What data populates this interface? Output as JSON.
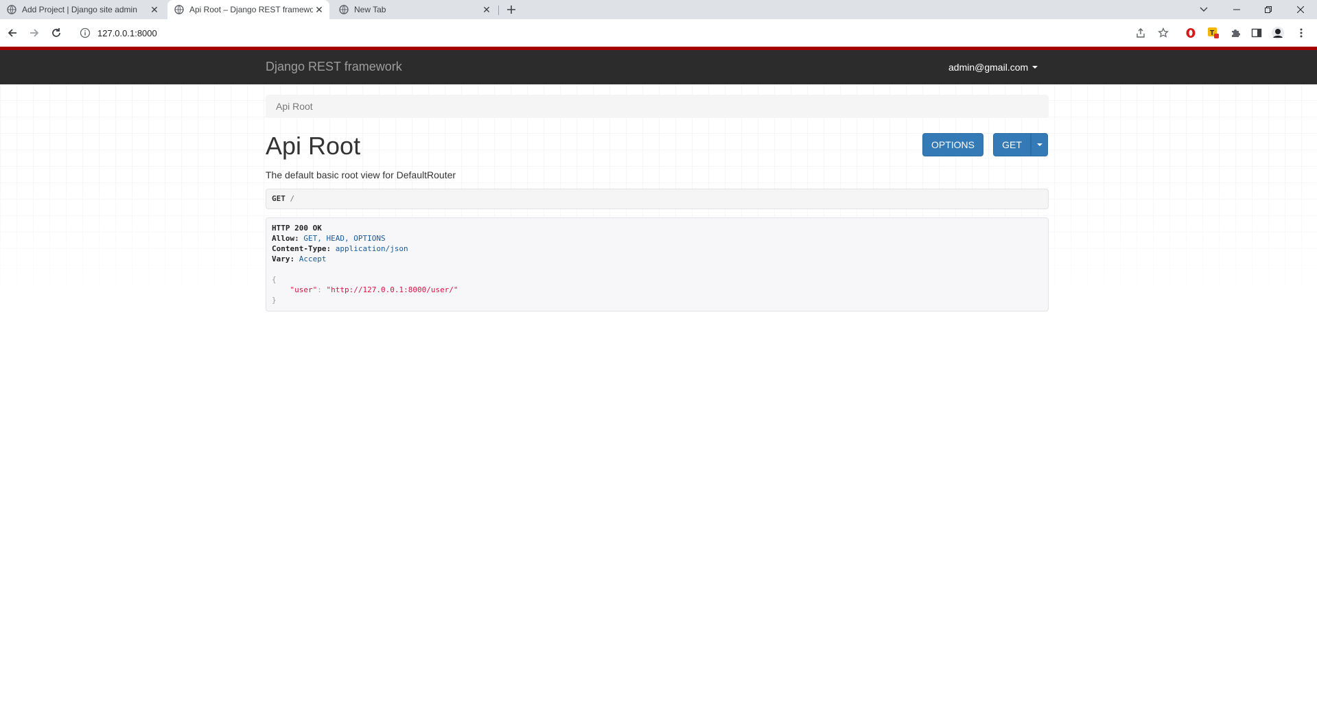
{
  "browser": {
    "tabs": [
      {
        "title": "Add Project | Django site admin",
        "active": false
      },
      {
        "title": "Api Root – Django REST framework",
        "active": true
      },
      {
        "title": "New Tab",
        "active": false
      }
    ],
    "new_tab_icon": "plus-icon",
    "url": "127.0.0.1:8000"
  },
  "navbar": {
    "brand": "Django REST framework",
    "user": "admin@gmail.com"
  },
  "breadcrumb": {
    "current": "Api Root"
  },
  "content": {
    "title": "Api Root",
    "description": "The default basic root view for DefaultRouter",
    "options_button": "OPTIONS",
    "get_button": "GET",
    "request": {
      "method": "GET",
      "path": "/"
    },
    "response": {
      "status": "HTTP 200 OK",
      "headers": [
        {
          "key": "Allow:",
          "value": "GET, HEAD, OPTIONS"
        },
        {
          "key": "Content-Type:",
          "value": "application/json"
        },
        {
          "key": "Vary:",
          "value": "Accept"
        }
      ],
      "body_open": "{",
      "body_key": "\"user\"",
      "body_sep": ": ",
      "body_value": "\"http://127.0.0.1:8000/user/\"",
      "body_close": "}"
    }
  },
  "colors": {
    "navbar_bg": "#2c2c2c",
    "navbar_accent": "#a30000",
    "button_primary": "#337ab7"
  }
}
